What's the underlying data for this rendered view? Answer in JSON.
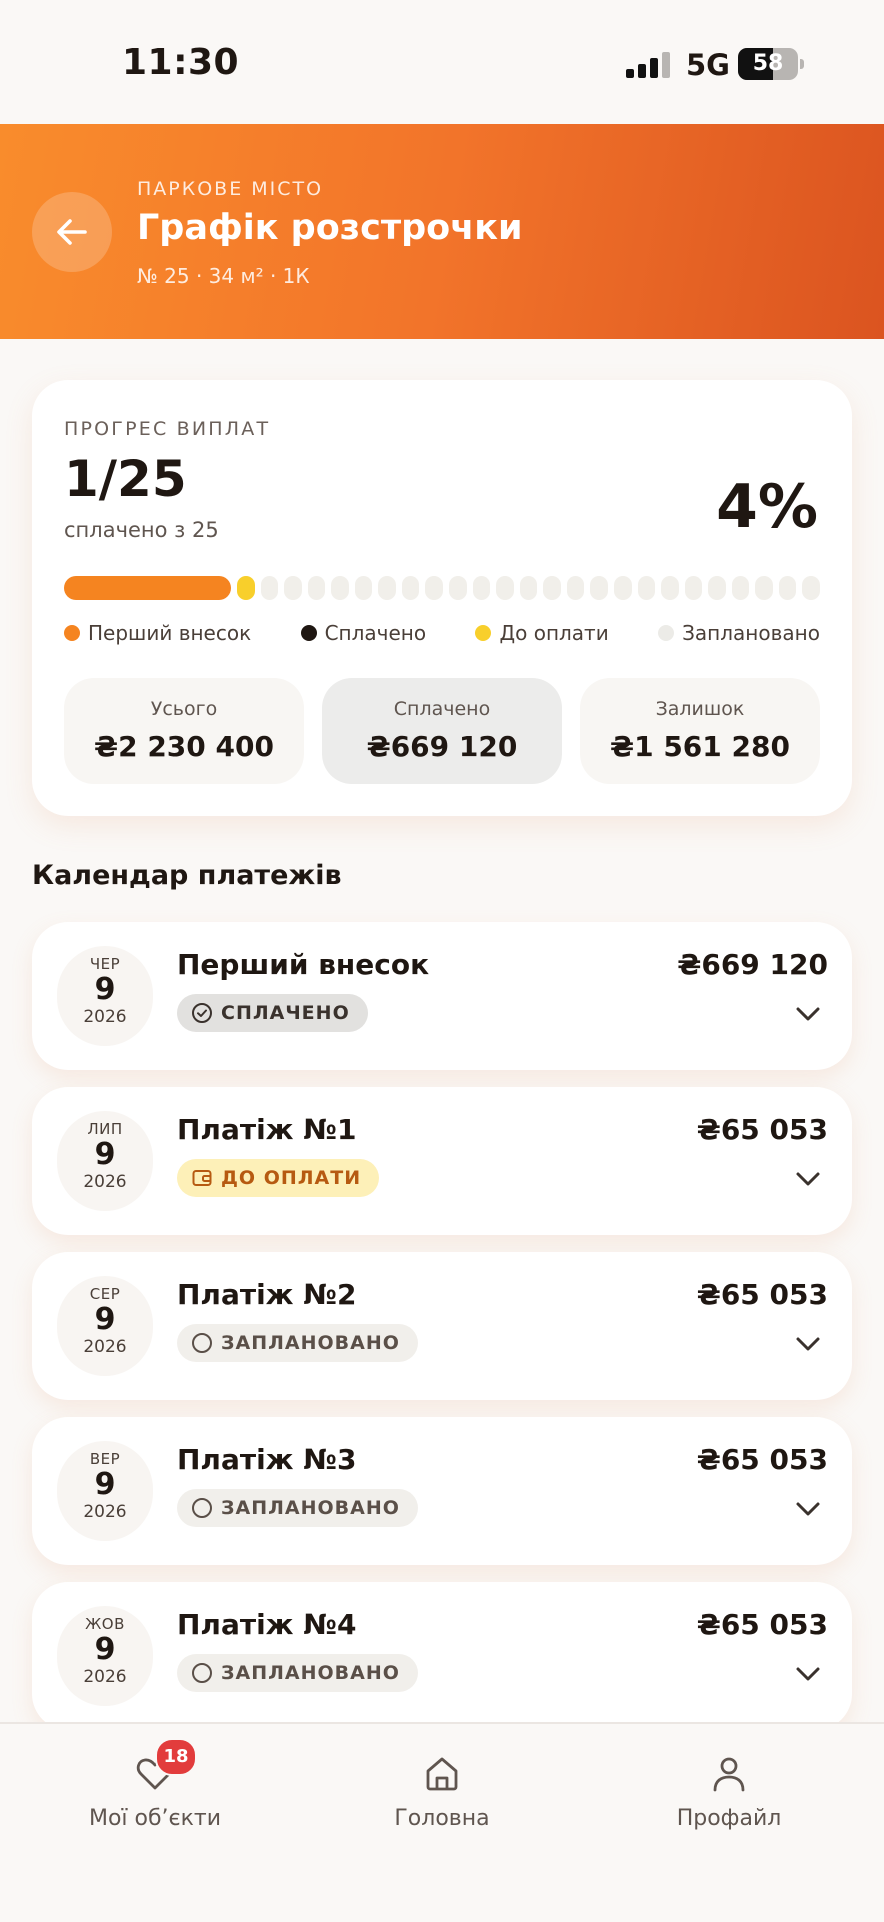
{
  "status_bar": {
    "time": "11:30",
    "network": "5G",
    "battery": "58",
    "battery_level": 0.58
  },
  "header": {
    "eyebrow": "ПАРКОВЕ МІСТО",
    "title": "Графік розстрочки",
    "subtitle": "№ 25 · 34 м² · 1К"
  },
  "colors": {
    "accent": "#f58420",
    "due": "#f8cf2b",
    "paid": "#1f1712",
    "planned": "#f1efea"
  },
  "progress": {
    "label": "ПРОГРЕС ВИПЛАТ",
    "count": "1/25",
    "of_text": "сплачено з 25",
    "percent": "4%",
    "segments": {
      "first_deposit_share": 0.3,
      "due_count": 1,
      "planned_count": 24
    },
    "legend": [
      {
        "label": "Перший внесок",
        "color": "#f58420"
      },
      {
        "label": "Сплачено",
        "color": "#1f1712"
      },
      {
        "label": "До оплати",
        "color": "#f8cf2b"
      },
      {
        "label": "Заплановано",
        "color": "#f1efea"
      }
    ],
    "stats": [
      {
        "label": "Усього",
        "value": "₴2 230 400"
      },
      {
        "label": "Сплачено",
        "value": "₴669 120"
      },
      {
        "label": "Залишок",
        "value": "₴1 561 280"
      }
    ]
  },
  "calendar": {
    "title": "Календар платежів",
    "payments": [
      {
        "month": "ЧЕР",
        "day": "9",
        "year": "2026",
        "title": "Перший внесок",
        "status": "СПЛАЧЕНО",
        "status_type": "paid",
        "amount": "₴669 120"
      },
      {
        "month": "ЛИП",
        "day": "9",
        "year": "2026",
        "title": "Платіж №1",
        "status": "ДО ОПЛАТИ",
        "status_type": "due",
        "amount": "₴65 053"
      },
      {
        "month": "СЕР",
        "day": "9",
        "year": "2026",
        "title": "Платіж №2",
        "status": "ЗАПЛАНОВАНО",
        "status_type": "plan",
        "amount": "₴65 053"
      },
      {
        "month": "ВЕР",
        "day": "9",
        "year": "2026",
        "title": "Платіж №3",
        "status": "ЗАПЛАНОВАНО",
        "status_type": "plan",
        "amount": "₴65 053"
      },
      {
        "month": "ЖОВ",
        "day": "9",
        "year": "2026",
        "title": "Платіж №4",
        "status": "ЗАПЛАНОВАНО",
        "status_type": "plan",
        "amount": "₴65 053"
      }
    ]
  },
  "nav": {
    "items": [
      {
        "label": "Мої об’єкти",
        "icon": "heart-icon",
        "badge": "18"
      },
      {
        "label": "Головна",
        "icon": "home-icon"
      },
      {
        "label": "Профайл",
        "icon": "user-icon"
      }
    ]
  }
}
